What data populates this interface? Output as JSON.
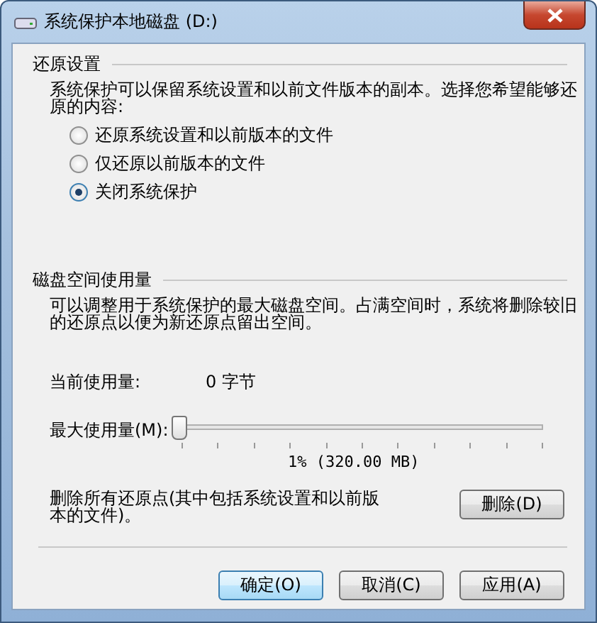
{
  "window": {
    "title": "系统保护本地磁盘 (D:)"
  },
  "restore_settings": {
    "heading": "还原设置",
    "description": "系统保护可以保留系统设置和以前文件版本的副本。选择您希望能够还原的内容:",
    "options": [
      {
        "label": "还原系统设置和以前版本的文件",
        "selected": false
      },
      {
        "label": "仅还原以前版本的文件",
        "selected": false
      },
      {
        "label": "关闭系统保护",
        "selected": true
      }
    ]
  },
  "disk_usage": {
    "heading": "磁盘空间使用量",
    "description": "可以调整用于系统保护的最大磁盘空间。占满空间时，系统将删除较旧的还原点以便为新还原点留出空间。",
    "current_label": "当前使用量:",
    "current_value": "0 字节",
    "max_label": "最大使用量(M):",
    "slider": {
      "level": 0.0
    },
    "slider_reading": "1% (320.00 MB)",
    "delete_text": "删除所有还原点(其中包括系统设置和以前版本的文件)。",
    "delete_button": "删除(D)"
  },
  "buttons": [
    {
      "label": "确定(O)",
      "default": true
    },
    {
      "label": "取消(C)",
      "default": false
    },
    {
      "label": "应用(A)",
      "default": false
    }
  ]
}
